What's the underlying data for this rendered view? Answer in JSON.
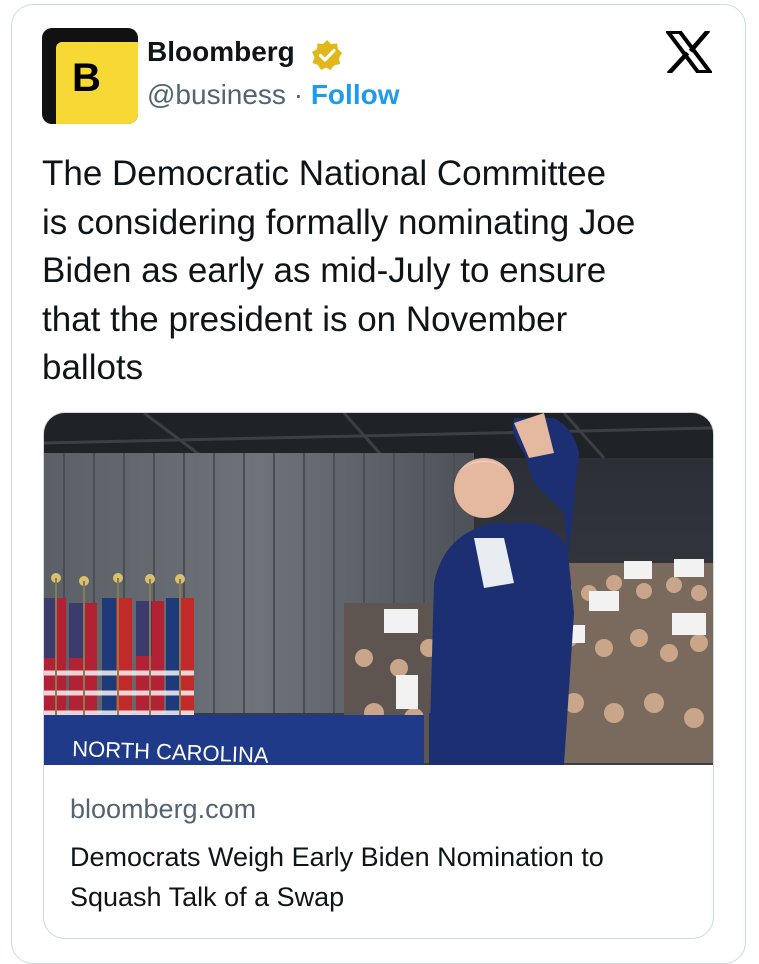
{
  "author": {
    "name": "Bloomberg",
    "avatar_letter": "B",
    "handle": "@business",
    "separator": " · ",
    "follow_label": "Follow",
    "verified_icon": "gold-check-badge",
    "brand_color": "#f7d835"
  },
  "platform_icon": "x-logo",
  "tweet": {
    "lines": [
      "The Democratic National Committee",
      "is considering formally nominating Joe",
      "Biden as early as mid-July to ensure",
      "that the president is on November",
      "ballots"
    ]
  },
  "link_card": {
    "domain": "bloomberg.com",
    "headline_lines": [
      "Democrats Weigh Early Biden Nomination to",
      "Squash Talk of a Swap"
    ],
    "photo_banner_text": "NORTH CAROLINA"
  },
  "colors": {
    "text": "#0f1419",
    "secondary": "#536471",
    "link": "#1d9bf0",
    "border": "#cfd9de"
  }
}
